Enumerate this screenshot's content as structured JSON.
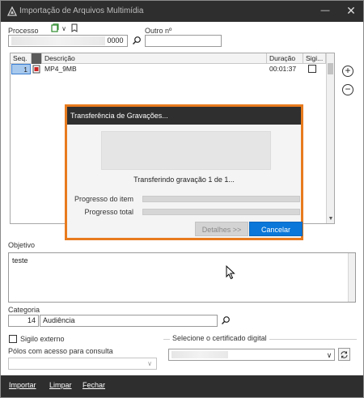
{
  "window": {
    "title": "Importação de Arquivos Multimídia",
    "minimize_glyph": "—",
    "close_glyph": "✕"
  },
  "processo": {
    "label": "Processo",
    "value_suffix": "0000",
    "search_icon": "search-icon"
  },
  "outro": {
    "label": "Outro nº",
    "value": ""
  },
  "grid": {
    "columns": [
      "Seq.",
      "",
      "Descrição",
      "Duração",
      "Sigi..."
    ],
    "rows": [
      {
        "seq": "1",
        "descricao": "MP4_9MB",
        "duracao": "00:01:37",
        "sigilo": false
      }
    ]
  },
  "side_buttons": {
    "add": "+",
    "remove": "−"
  },
  "modal": {
    "title": "Transferência de Gravações...",
    "status": "Transferindo gravação 1 de 1...",
    "progress_item_label": "Progresso do item",
    "progress_item": 0,
    "progress_total_label": "Progresso total",
    "progress_total": 0,
    "details_button": "Detalhes >>",
    "cancel_button": "Cancelar",
    "accent_color": "#e87b1e"
  },
  "objetivo": {
    "label": "Objetivo",
    "value": "teste"
  },
  "categoria": {
    "label": "Categoria",
    "code": "14",
    "value": "Audiência"
  },
  "sigilo_externo": {
    "label": "Sigilo externo",
    "checked": false
  },
  "polos": {
    "label": "Pólos com acesso para consulta",
    "value": ""
  },
  "certificado": {
    "label": "Selecione o certificado digital",
    "value": ""
  },
  "footer": {
    "importar": "Importar",
    "limpar": "Limpar",
    "fechar": "Fechar"
  }
}
